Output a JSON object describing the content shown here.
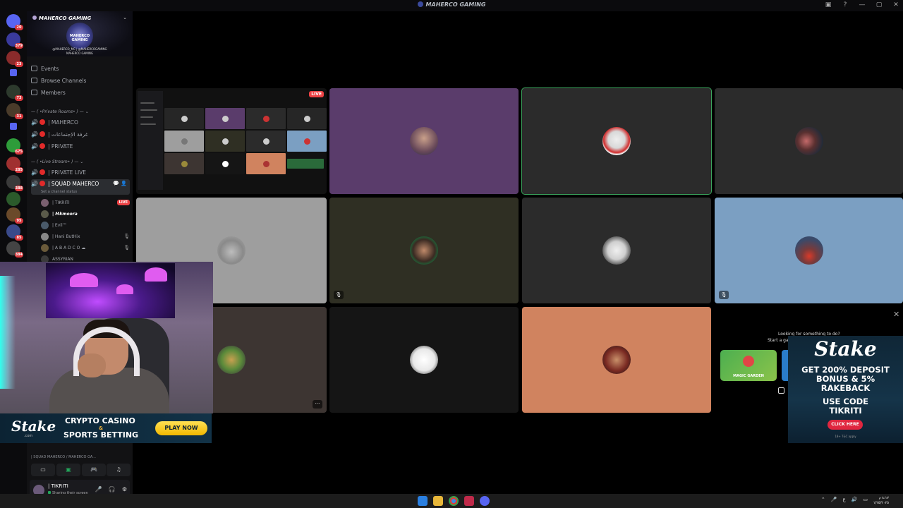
{
  "window": {
    "title": "MAHERCO GAMING"
  },
  "titlebar_icons": [
    "inbox-icon",
    "help-icon",
    "minimize-icon",
    "maximize-icon",
    "close-icon"
  ],
  "server_rail": {
    "badges": [
      "20",
      "379",
      "9",
      "23",
      "",
      "",
      "73",
      "31",
      "",
      "675",
      "285",
      "388",
      "",
      "95",
      "85",
      "384"
    ]
  },
  "sidebar": {
    "server_name": "MAHERCO GAMING",
    "emblem_text": "MAHERCO GAMING",
    "banner_tag1": "@MAHERCO_MC  |  @MAHERCOGAMING",
    "banner_tag2": "MAHERCO GAMING",
    "nav": [
      {
        "label": "Events"
      },
      {
        "label": "Browse Channels"
      },
      {
        "label": "Members"
      }
    ],
    "category_private": "— ( •Private Rooms• ) —",
    "private_channels": [
      {
        "label": "| MAHERCO"
      },
      {
        "label": "| غرفة الإجتماعات"
      },
      {
        "label": "| PRIVATE"
      }
    ],
    "category_live": "— ( •Live Stream• ) —",
    "live_channels": [
      {
        "label": "| PRIVATE LIVE"
      },
      {
        "label": "| SQUAD MAHERCO"
      }
    ],
    "channel_status": "Set a channel status",
    "members": [
      {
        "name": "| TIKRITI",
        "badge": "LIVE"
      },
      {
        "name": "| Mkmoora",
        "badge": ""
      },
      {
        "name": "| Evil™",
        "badge": ""
      },
      {
        "name": "| Hani ButHix",
        "badge": ""
      },
      {
        "name": "| A B A D C O ☁",
        "badge": ""
      },
      {
        "name": "ASSYRIAN",
        "badge": ""
      }
    ],
    "voice_label": "| SQUAD MAHERCO / MAHERCO GA...",
    "user": {
      "name": "| TIKRITI",
      "status": "Sharing their screen"
    }
  },
  "tiles": {
    "live_badge": "LIVE"
  },
  "activity": {
    "line1": "Looking for something to do?",
    "line2": "Start a ga",
    "game_title": "MAGIC GARDEN"
  },
  "stake_left": {
    "logo": "Stake",
    "sub": ".com",
    "line1": "CRYPTO CASINO",
    "amp": "&",
    "line2": "SPORTS BETTING",
    "cta": "PLAY NOW"
  },
  "stake_right": {
    "logo": "Stake",
    "line1a": "GET 200% DEPOSIT",
    "line1b": "BONUS & 5%",
    "line1c": "RAKEBACK",
    "line2a": "USE CODE",
    "line2b": "TIKRITI",
    "cta": "CLICK HERE",
    "foot": "18+ T&C apply"
  },
  "taskbar": {
    "time": "٨:١٧ م",
    "date": "١/٢٥/٢٠٢٥"
  },
  "colors": {
    "tile_purple": "#5a3c6b",
    "tile_dark": "#2b2b2b",
    "tile_gray": "#9e9e9e",
    "tile_olive": "#2f2f23",
    "tile_blue": "#7b9fc2",
    "tile_brown": "#3d3532",
    "tile_black": "#151515",
    "tile_orange": "#d0835f",
    "speaking": "#3ba55d",
    "live": "#ed4245"
  }
}
